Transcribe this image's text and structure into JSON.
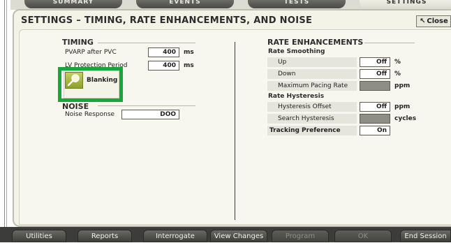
{
  "tabs": [
    {
      "label": "SUMMARY"
    },
    {
      "label": "EVENTS"
    },
    {
      "label": "TESTS"
    },
    {
      "label": "SETTINGS"
    }
  ],
  "dialog": {
    "title": "SETTINGS – TIMING, RATE ENHANCEMENTS, AND NOISE",
    "close_label": "Close"
  },
  "timing": {
    "header": "TIMING",
    "rows": [
      {
        "label": "PVARP after PVC",
        "value": "400",
        "unit": "ms"
      },
      {
        "label": "LV Protection Period",
        "value": "400",
        "unit": "ms"
      }
    ],
    "blanking_label": "Blanking"
  },
  "noise": {
    "header": "NOISE",
    "response_label": "Noise Response",
    "response_value": "DOO"
  },
  "rate_enhancements": {
    "header": "RATE ENHANCEMENTS",
    "smoothing_header": "Rate Smoothing",
    "up_label": "Up",
    "up_value": "Off",
    "up_unit": "%",
    "down_label": "Down",
    "down_value": "Off",
    "down_unit": "%",
    "max_rate_label": "Maximum Pacing Rate",
    "max_rate_unit": "ppm",
    "hysteresis_header": "Rate Hysteresis",
    "offset_label": "Hysteresis Offset",
    "offset_value": "Off",
    "offset_unit": "ppm",
    "search_label": "Search Hysteresis",
    "search_unit": "cycles",
    "tracking_label": "Tracking Preference",
    "tracking_value": "On"
  },
  "bottom_bar": {
    "utilities": "Utilities",
    "reports": "Reports",
    "interrogate": "Interrogate",
    "view_changes": "View Changes",
    "program": "Program",
    "ok": "OK",
    "end_session": "End Session"
  },
  "colors": {
    "highlight": "#17a63c",
    "panel": "#f3f3e8",
    "bottom_bar": "#3c3c3a"
  }
}
